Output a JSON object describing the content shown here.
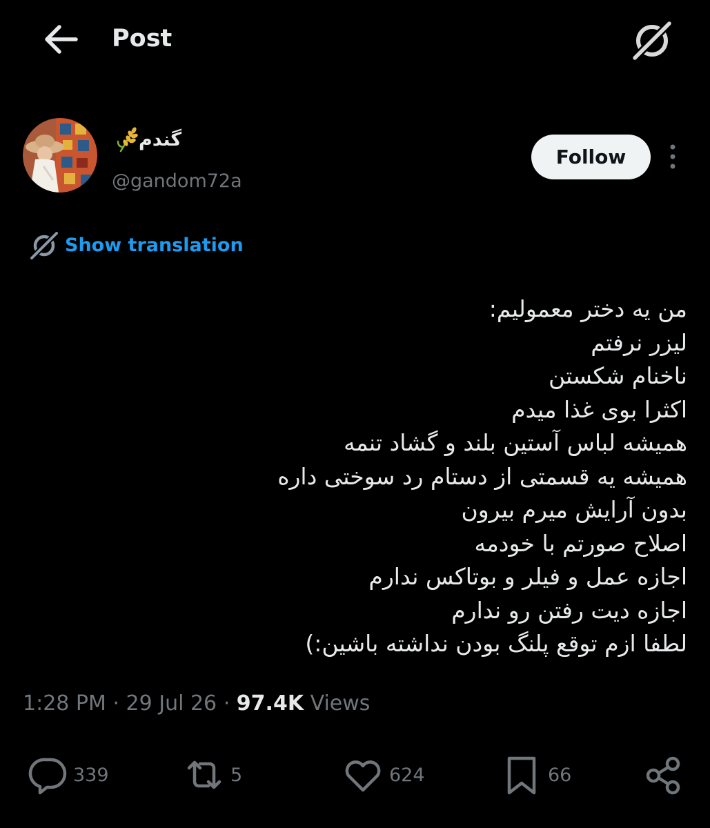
{
  "header": {
    "title": "Post"
  },
  "author": {
    "display_name": "گندم",
    "handle": "@gandom72a",
    "follow_label": "Follow"
  },
  "translation": {
    "label": "Show translation"
  },
  "post": {
    "lines": [
      "من یه دختر معمولیم:",
      "لیزر نرفتم",
      "ناخنام شکستن",
      "اکثرا بوی غذا میدم",
      "همیشه لباس آستین بلند و گشاد تنمه",
      "همیشه یه قسمتی از دستام رد سوختی داره",
      "بدون آرایش میرم بیرون",
      "اصلاح صورتم با خودمه",
      "اجازه عمل و فیلر و بوتاکس ندارم",
      "اجازه دیت رفتن رو ندارم",
      "لطفا ازم توقع پلنگ بودن نداشته باشین:)"
    ]
  },
  "meta": {
    "time": "1:28 PM",
    "separator": "·",
    "date": "29 Jul 26",
    "views_count": "97.4K",
    "views_label": "Views"
  },
  "actions": {
    "replies": "339",
    "reposts": "5",
    "likes": "624",
    "bookmarks": "66"
  },
  "colors": {
    "background": "#000000",
    "text_primary": "#e7e9ea",
    "text_secondary": "#71767b",
    "link": "#1d9bf0",
    "follow_bg": "#eff3f4"
  },
  "icons": {
    "back": "arrow-left-icon",
    "grok": "grok-icon",
    "more": "more-vertical-icon",
    "translate": "grok-icon",
    "wheat": "wheat-emoji-icon",
    "reply": "reply-icon",
    "repost": "repost-icon",
    "like": "heart-icon",
    "bookmark": "bookmark-icon",
    "share": "share-icon"
  }
}
